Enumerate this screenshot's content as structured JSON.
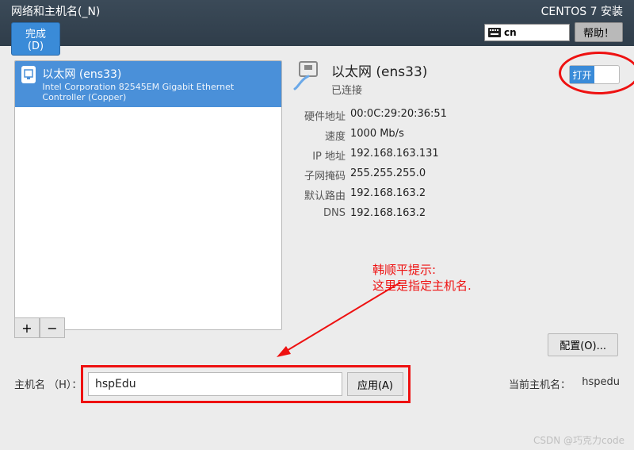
{
  "header": {
    "title": "网络和主机名(_N)",
    "done_btn": "完成(D)",
    "installer": "CENTOS 7 安装",
    "lang_code": "cn",
    "help_btn": "帮助！"
  },
  "device_list": {
    "items": [
      {
        "name": "以太网 (ens33)",
        "sub": "Intel Corporation 82545EM Gigabit Ethernet Controller (Copper)"
      }
    ],
    "plus": "+",
    "minus": "−"
  },
  "nic": {
    "title": "以太网 (ens33)",
    "status": "已连接",
    "toggle_on": "打开",
    "info": {
      "hwaddr_label": "硬件地址",
      "hwaddr": "00:0C:29:20:36:51",
      "speed_label": "速度",
      "speed": "1000 Mb/s",
      "ip_label": "IP 地址",
      "ip": "192.168.163.131",
      "mask_label": "子网掩码",
      "mask": "255.255.255.0",
      "gw_label": "默认路由",
      "gw": "192.168.163.2",
      "dns_label": "DNS",
      "dns": "192.168.163.2"
    }
  },
  "annotation": {
    "line1": "韩顺平提示:",
    "line2": "这里是指定主机名."
  },
  "config_btn": "配置(O)...",
  "hostname": {
    "label": "主机名 （H）：",
    "value": "hspEdu",
    "apply": "应用(A)",
    "current_label": "当前主机名：",
    "current_value": "hspedu"
  },
  "watermark": "CSDN @巧克力code"
}
